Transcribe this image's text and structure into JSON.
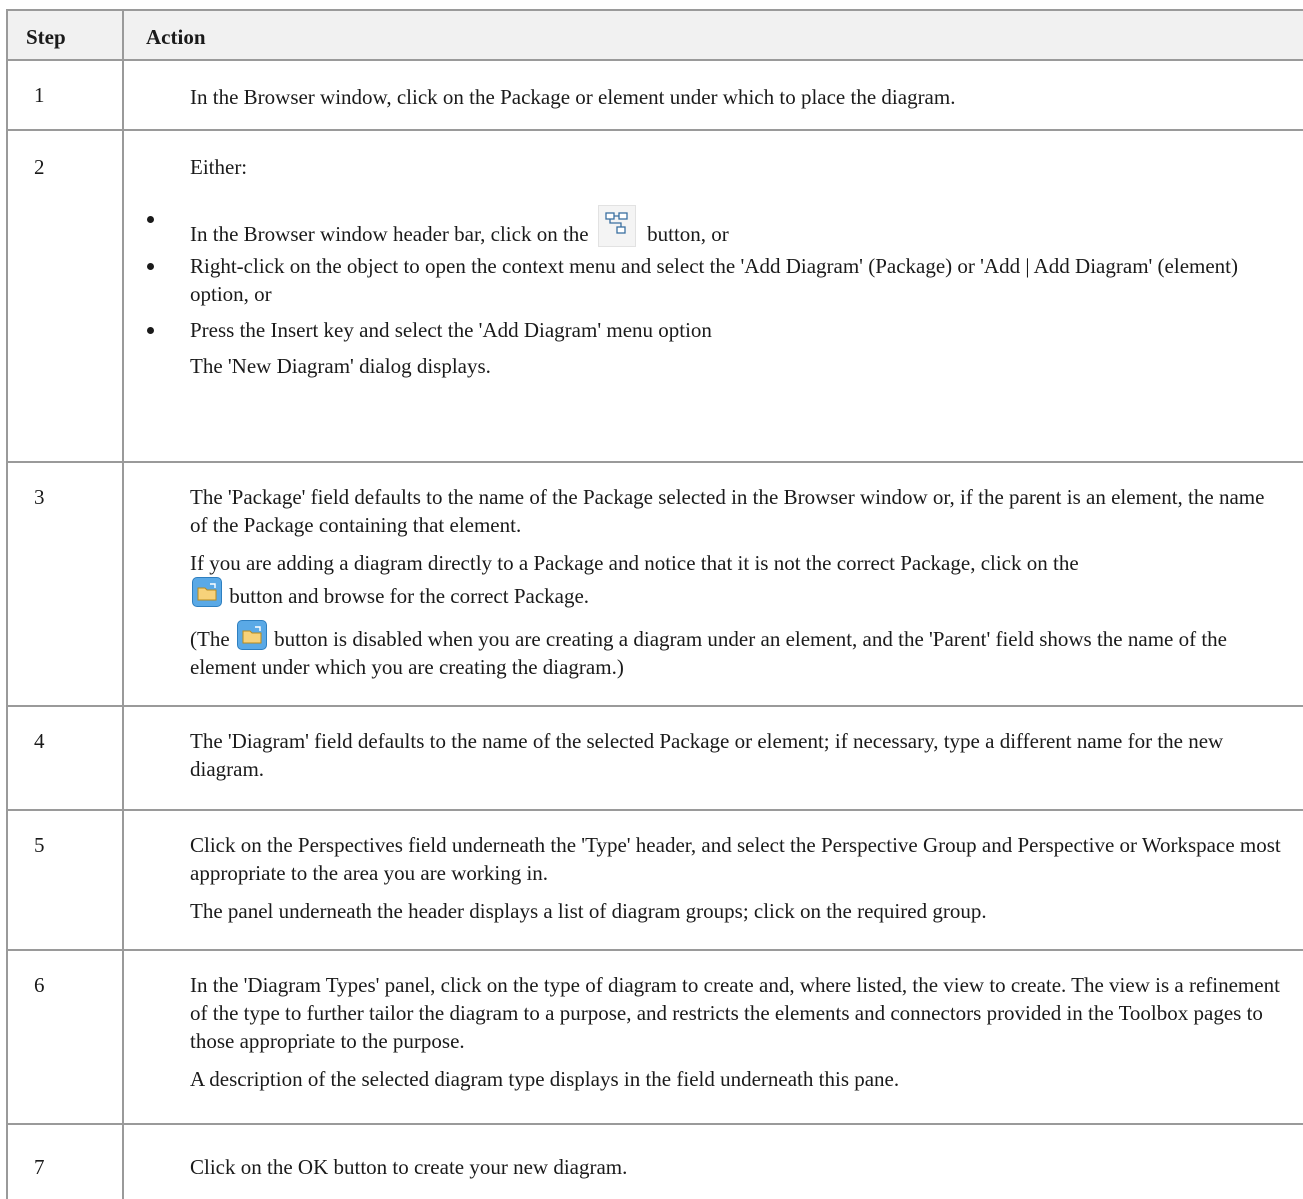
{
  "header": {
    "step": "Step",
    "action": "Action"
  },
  "rows": [
    {
      "step": "1",
      "text": "In the Browser window, click on the Package or element under which to place the diagram."
    },
    {
      "step": "2",
      "intro": "Either:",
      "bullet1_pre": "In the Browser window header bar, click on the",
      "bullet1_post": "button, or",
      "bullet2": "Right-click on the object to open the context menu and select the 'Add Diagram' (Package) or 'Add | Add Diagram' (element) option, or",
      "bullet3": "Press the Insert key and select the 'Add Diagram' menu option",
      "outro": "The 'New Diagram' dialog displays."
    },
    {
      "step": "3",
      "p1": "The 'Package' field defaults to the name of the Package selected in the Browser window or, if the parent is an element, the name of the Package containing that element.",
      "p2_pre": "If you are adding a diagram directly to a Package and notice that it is not the correct Package, click on the",
      "p2_post": "button and browse for the correct Package.",
      "p3_pre": "(The",
      "p3_post": "button is disabled when you are creating a diagram under an element, and the 'Parent' field shows the name of the element under which you are creating the diagram.)"
    },
    {
      "step": "4",
      "text": "The 'Diagram' field defaults to the name of the selected Package or element; if necessary, type a different name for the new diagram."
    },
    {
      "step": "5",
      "p1": "Click on the Perspectives field underneath the 'Type' header, and select the Perspective Group and Perspective or Workspace most appropriate to the area you are working in.",
      "p2": "The panel underneath the header displays a list of diagram groups; click on the required group."
    },
    {
      "step": "6",
      "p1": "In the 'Diagram Types' panel, click on the type of diagram to create and, where listed, the view to create. The view is a refinement of the type to further tailor the diagram to a purpose, and restricts the elements and connectors provided in the Toolbox pages to those appropriate to the purpose.",
      "p2": "A description of the selected diagram type displays in the field underneath this pane."
    },
    {
      "step": "7",
      "text": "Click on the OK button to create your new diagram."
    }
  ]
}
